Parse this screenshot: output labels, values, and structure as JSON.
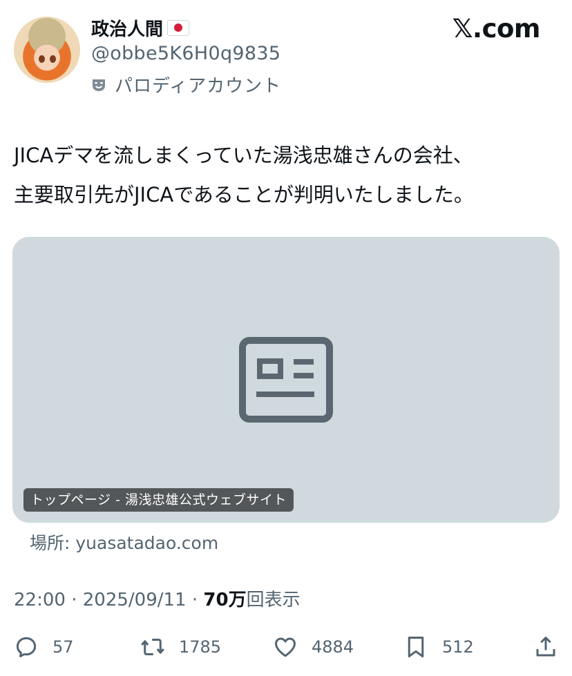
{
  "author": {
    "display_name": "政治人間",
    "flag_icon": "japan-flag-icon",
    "handle": "@obbe5K6H0q9835",
    "parody_label": "パロディアカウント"
  },
  "brand": "𝕏.com",
  "tweet": {
    "lines": [
      "JICAデマを流しまくっていた湯浅忠雄さんの会社、",
      "主要取引先がJICAであることが判明いたしました。"
    ]
  },
  "card": {
    "icon": "article-icon",
    "title": "トップページ - 湯浅忠雄公式ウェブサイト",
    "source": "場所: yuasatadao.com"
  },
  "meta": {
    "time": "22:00",
    "separator": " · ",
    "date": "2025/09/11",
    "views_count": "70万",
    "views_label": "回表示"
  },
  "actions": {
    "replies": "57",
    "reposts": "1785",
    "likes": "4884",
    "bookmarks": "512"
  },
  "colors": {
    "text": "#0f1419",
    "muted": "#536471",
    "card_bg": "#cfd9de",
    "icon_gray": "#5b6770"
  }
}
